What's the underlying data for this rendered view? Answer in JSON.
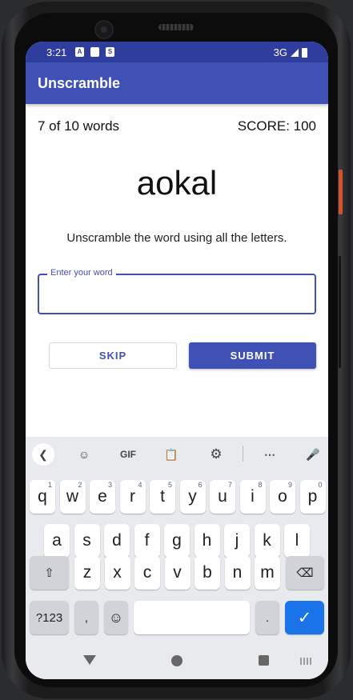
{
  "status_bar": {
    "time": "3:21",
    "network": "3G"
  },
  "app_bar": {
    "title": "Unscramble"
  },
  "game": {
    "word_count": "7 of 10 words",
    "score": "SCORE: 100",
    "scrambled_word": "aokal",
    "instructions": "Unscramble the word using all the letters."
  },
  "input": {
    "label": "Enter your word",
    "value": ""
  },
  "buttons": {
    "skip": "SKIP",
    "submit": "SUBMIT"
  },
  "keyboard": {
    "toolbar": {
      "gif": "GIF"
    },
    "row1": [
      {
        "k": "q",
        "h": "1"
      },
      {
        "k": "w",
        "h": "2"
      },
      {
        "k": "e",
        "h": "3"
      },
      {
        "k": "r",
        "h": "4"
      },
      {
        "k": "t",
        "h": "5"
      },
      {
        "k": "y",
        "h": "6"
      },
      {
        "k": "u",
        "h": "7"
      },
      {
        "k": "i",
        "h": "8"
      },
      {
        "k": "o",
        "h": "9"
      },
      {
        "k": "p",
        "h": "0"
      }
    ],
    "row2": [
      "a",
      "s",
      "d",
      "f",
      "g",
      "h",
      "j",
      "k",
      "l"
    ],
    "row3": [
      "z",
      "x",
      "c",
      "v",
      "b",
      "n",
      "m"
    ],
    "symbols": "?123",
    "comma": ",",
    "period": "."
  },
  "colors": {
    "primary": "#3f51b5",
    "status_bar": "#2f3e9e",
    "enter_key": "#1a73e8"
  }
}
